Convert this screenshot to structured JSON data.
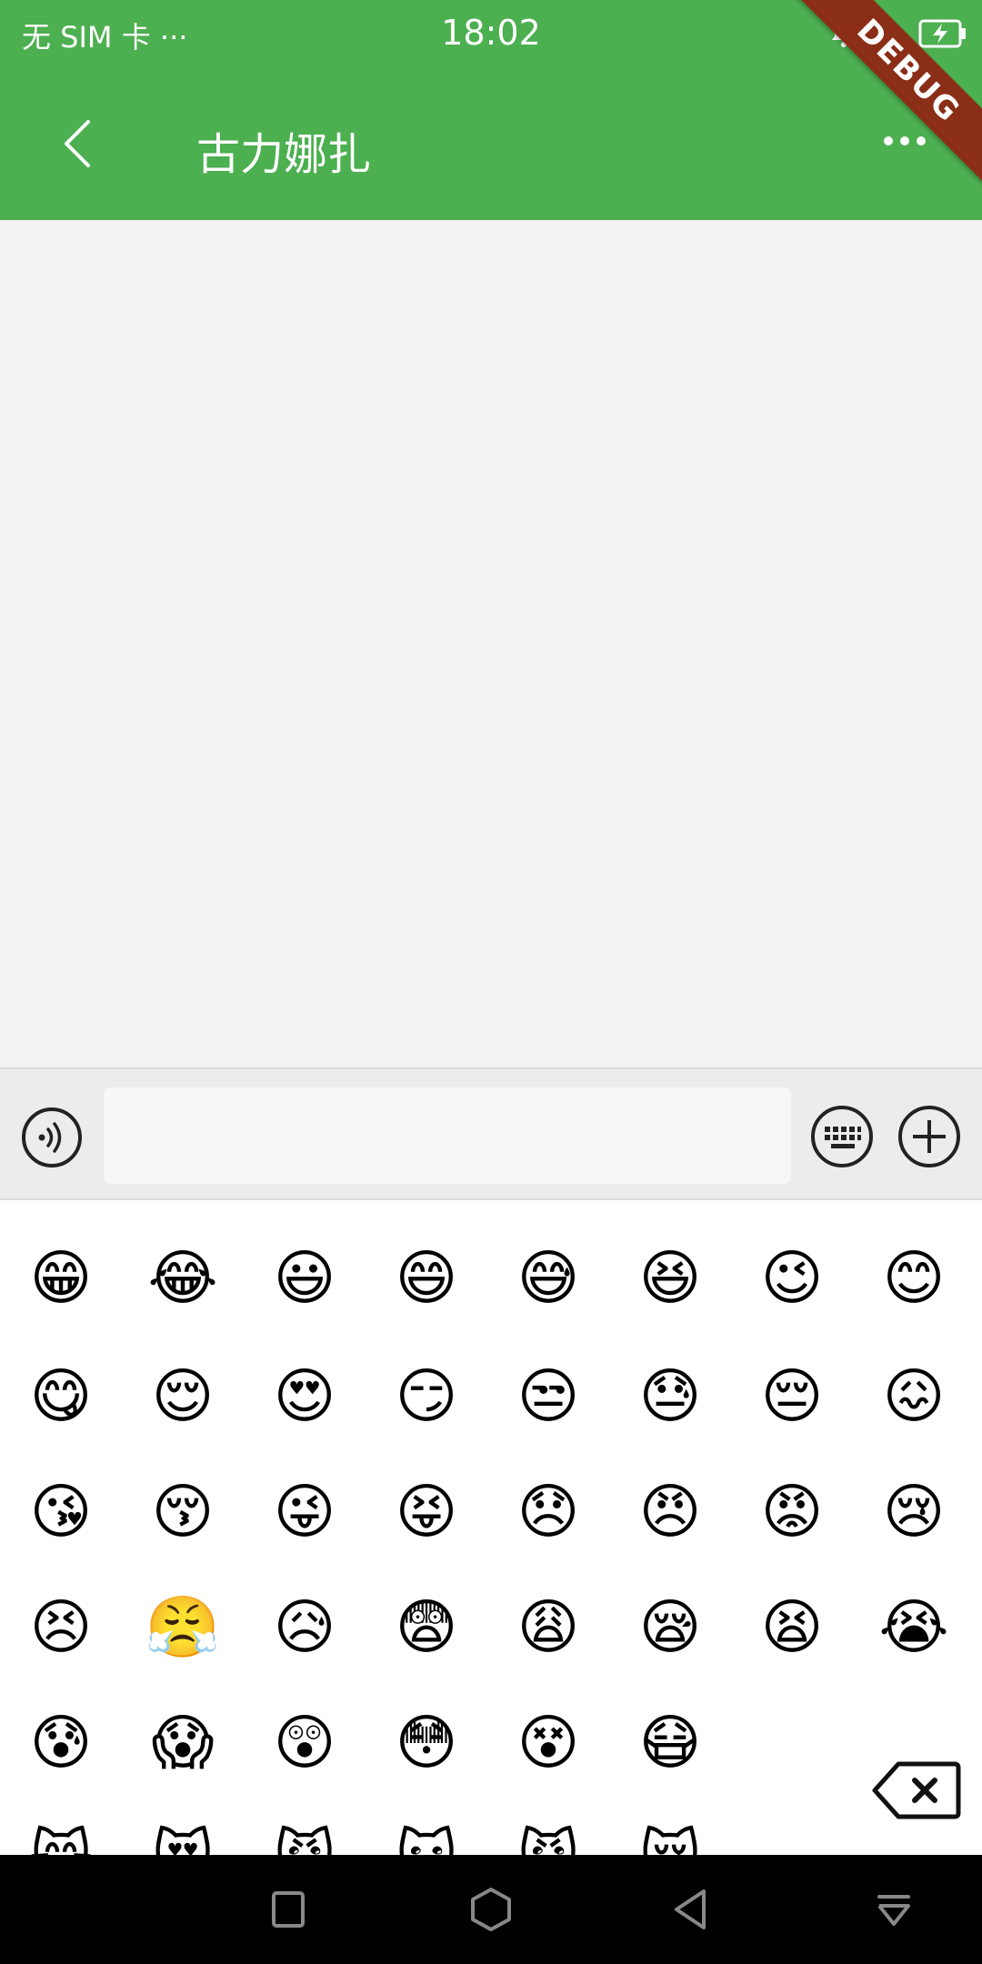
{
  "status_bar": {
    "carrier": "无 SIM 卡",
    "dots": "···",
    "time": "18:02"
  },
  "debug_banner": "DEBUG",
  "toolbar": {
    "title": "古力娜扎"
  },
  "input": {
    "value": "",
    "placeholder": ""
  },
  "emoji_panel": {
    "rows": [
      [
        "😁",
        "😂",
        "😃",
        "😄",
        "😅",
        "😆",
        "😉",
        "😊"
      ],
      [
        "😋",
        "😌",
        "😍",
        "😏",
        "😒",
        "😓",
        "😔",
        "😖"
      ],
      [
        "😘",
        "😚",
        "😜",
        "😝",
        "😞",
        "😠",
        "😡",
        "😢"
      ],
      [
        "😣",
        "😤",
        "😥",
        "😨",
        "😩",
        "😪",
        "😫",
        "😭"
      ],
      [
        "😰",
        "😱",
        "😲",
        "😳",
        "😵",
        "😷"
      ],
      [
        "😸",
        "😻",
        "😼",
        "😽",
        "😾",
        "😿"
      ]
    ]
  },
  "colors": {
    "primary": "#4caf50",
    "debug_ribbon": "#8b2e17",
    "navbar": "#000000"
  }
}
